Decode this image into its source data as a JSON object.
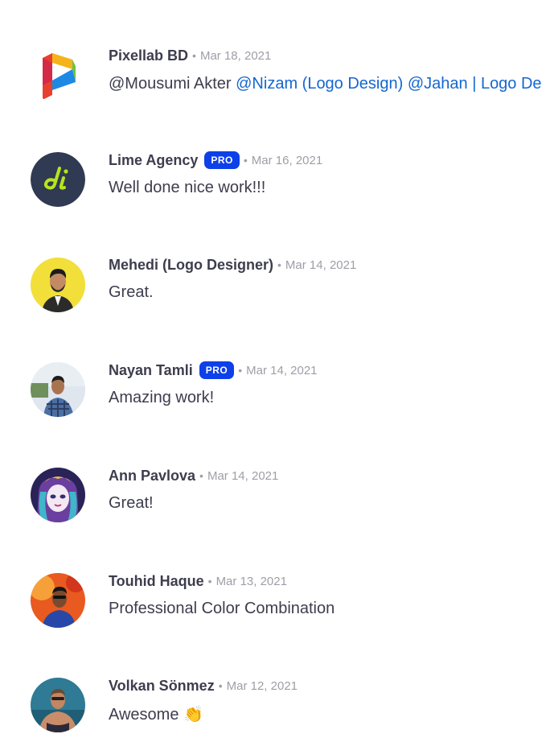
{
  "comments": [
    {
      "author": "Pixellab BD",
      "pro": false,
      "date": "Mar 18, 2021",
      "text_plain": "@Mousumi Akter ",
      "text_mention": "@Nizam (Logo Design) @Jahan | Logo De",
      "avatar_icon": "pixellab-logo-icon"
    },
    {
      "author": "Lime Agency",
      "pro": true,
      "pro_label": "PRO",
      "date": "Mar 16, 2021",
      "text_plain": "Well done nice work!!!",
      "avatar_icon": "lime-agency-logo-icon"
    },
    {
      "author": "Mehedi (Logo Designer)",
      "pro": false,
      "date": "Mar 14, 2021",
      "text_plain": "Great.",
      "avatar_icon": "person-photo-icon"
    },
    {
      "author": "Nayan Tamli",
      "pro": true,
      "pro_label": "PRO",
      "date": "Mar 14, 2021",
      "text_plain": "Amazing work!",
      "avatar_icon": "person-photo-icon"
    },
    {
      "author": "Ann Pavlova",
      "pro": false,
      "date": "Mar 14, 2021",
      "text_plain": "Great!",
      "avatar_icon": "illustrated-character-icon"
    },
    {
      "author": "Touhid Haque",
      "pro": false,
      "date": "Mar 13, 2021",
      "text_plain": "Professional Color Combination",
      "avatar_icon": "person-photo-icon"
    },
    {
      "author": "Volkan Sönmez",
      "pro": false,
      "date": "Mar 12, 2021",
      "text_plain": "Awesome ",
      "emoji": "👏",
      "avatar_icon": "person-photo-icon"
    }
  ],
  "separator": "•",
  "colors": {
    "author": "#3d3d4e",
    "date": "#9e9ea7",
    "mention": "#1566d1",
    "pro_badge": "#0d40e8"
  }
}
